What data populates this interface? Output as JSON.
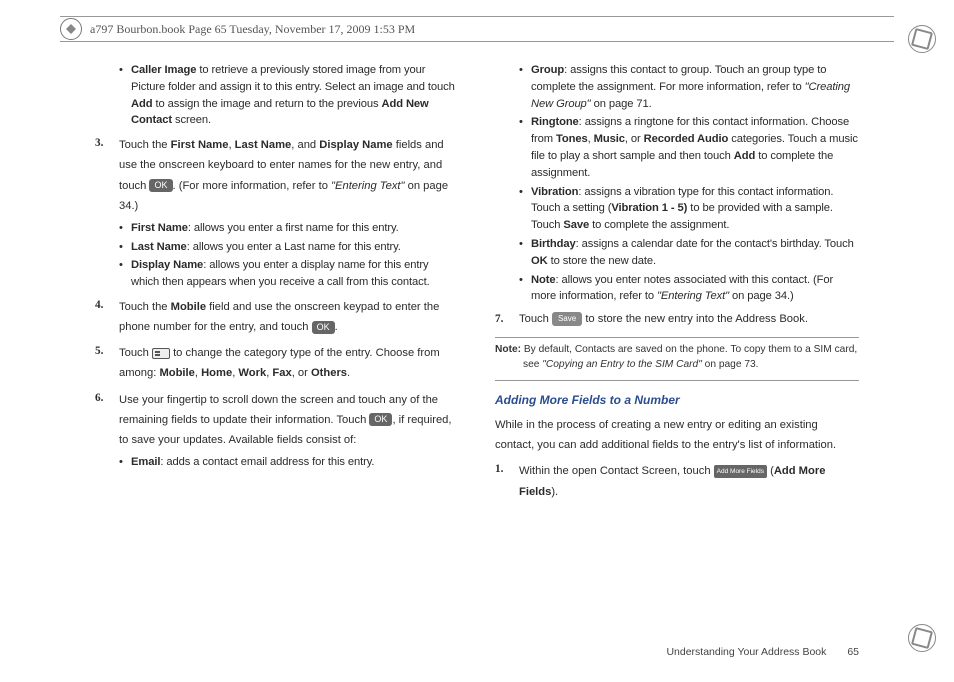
{
  "header": {
    "text": "a797 Bourbon.book  Page 65  Tuesday, November 17, 2009  1:53 PM"
  },
  "badges": {
    "ok": "OK",
    "save": "Save",
    "add_more_fields": "Add More Fields"
  },
  "col1": {
    "caller_image_label": "Caller Image",
    "caller_image_text_a": " to retrieve a previously stored image from your Picture folder and assign it to this entry. Select an image and touch ",
    "add_label": "Add",
    "caller_image_text_b": " to assign the image and return to the previous ",
    "add_new_contact_label": "Add New Contact",
    "caller_image_text_c": " screen.",
    "step3_a": "Touch the ",
    "step3_fn": "First Name",
    "step3_sep1": ", ",
    "step3_ln": "Last Name",
    "step3_sep2": ", and ",
    "step3_dn": "Display Name",
    "step3_b": " fields and use the onscreen keyboard to enter names for the new entry, and touch ",
    "step3_c": ". (For more information, refer to ",
    "step3_ref": "\"Entering Text\"",
    "step3_d": "  on page 34.)",
    "fn_label": "First Name",
    "fn_text": ": allows you enter a first name for this entry.",
    "ln_label": "Last Name",
    "ln_text": ": allows you enter a Last name for this entry.",
    "dn_label": "Display Name",
    "dn_text": ": allows you enter a display name for this entry which then appears when you receive a call from this contact.",
    "step4_a": "Touch the ",
    "step4_mobile": "Mobile",
    "step4_b": " field and use the onscreen keypad to enter the phone number for the entry, and touch ",
    "step4_c": ".",
    "step5_a": "Touch ",
    "step5_b": " to change the category type of the entry. Choose from among: ",
    "step5_m": "Mobile",
    "step5_sep1": ", ",
    "step5_h": "Home",
    "step5_sep2": ", ",
    "step5_w": "Work",
    "step5_sep3": ", ",
    "step5_f": "Fax",
    "step5_sep4": ", or ",
    "step5_o": "Others",
    "step5_c": ".",
    "step6_a": "Use your fingertip to scroll down the screen and touch any of the remaining fields to update their information. Touch ",
    "step6_b": ", if required, to save your updates. Available fields consist of:",
    "email_label": "Email",
    "email_text": ": adds a contact email address for this entry."
  },
  "col2": {
    "group_label": "Group",
    "group_text_a": ": assigns this contact to group. Touch an group type to complete the assignment. For more information, refer to ",
    "group_ref": "\"Creating New Group\"",
    "group_text_b": "  on page 71.",
    "ringtone_label": "Ringtone",
    "ringtone_text_a": ": assigns a ringtone for this contact information. Choose from ",
    "ringtone_t": "Tones",
    "ringtone_sep1": ", ",
    "ringtone_m": "Music",
    "ringtone_sep2": ", or ",
    "ringtone_r": "Recorded Audio",
    "ringtone_text_b": " categories. Touch a music file to play a short sample and then touch ",
    "ringtone_add": "Add",
    "ringtone_text_c": " to complete the assignment.",
    "vibration_label": "Vibration",
    "vibration_text_a": ": assigns a vibration type for this contact information. Touch a setting (",
    "vibration_range": "Vibration 1 - 5)",
    "vibration_text_b": " to be provided with a sample. Touch ",
    "vibration_save": "Save",
    "vibration_text_c": " to complete the assignment.",
    "birthday_label": "Birthday",
    "birthday_text_a": ": assigns a calendar date for the contact's birthday. Touch ",
    "birthday_ok": "OK",
    "birthday_text_b": " to store the new date.",
    "note_label": "Note",
    "note_text_a": ": allows you enter notes associated with this contact. (For more information, refer to ",
    "note_ref": "\"Entering Text\"",
    "note_text_b": "  on page 34.)",
    "step7_a": "Touch ",
    "step7_b": " to store the new entry into the Address Book.",
    "notice_label": "Note:",
    "notice_text_a": " By default, Contacts are saved on the phone. To copy them to a SIM card, see ",
    "notice_ref": "\"Copying an Entry to the SIM Card\"",
    "notice_text_b": " on page 73.",
    "heading": "Adding More Fields to a Number",
    "intro": "While in the process of creating a new entry or editing an existing contact, you can add additional fields to the entry's list of information.",
    "step1_a": "Within the open Contact Screen, touch ",
    "step1_b": " (",
    "step1_label": "Add More Fields",
    "step1_c": ")."
  },
  "footer": {
    "section": "Understanding Your Address Book",
    "page": "65"
  }
}
